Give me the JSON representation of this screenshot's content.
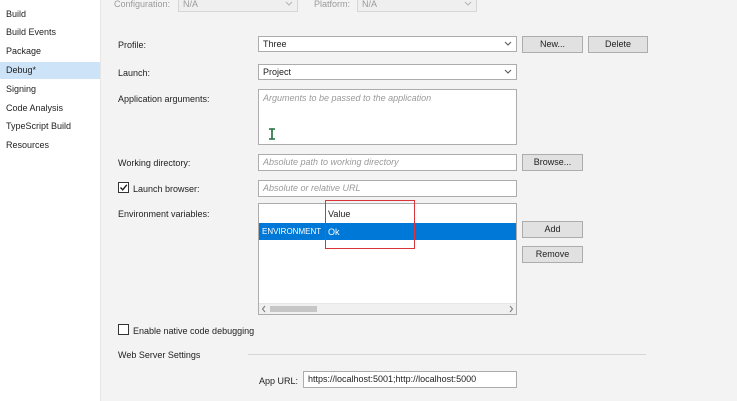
{
  "sidebar": {
    "items": [
      {
        "label": "Build"
      },
      {
        "label": "Build Events"
      },
      {
        "label": "Package"
      },
      {
        "label": "Debug*"
      },
      {
        "label": "Signing"
      },
      {
        "label": "Code Analysis"
      },
      {
        "label": "TypeScript Build"
      },
      {
        "label": "Resources"
      }
    ]
  },
  "top": {
    "configuration_label": "Configuration:",
    "configuration_value": "N/A",
    "platform_label": "Platform:",
    "platform_value": "N/A"
  },
  "profile": {
    "label": "Profile:",
    "value": "Three",
    "new_button": "New...",
    "delete_button": "Delete"
  },
  "launch": {
    "label": "Launch:",
    "value": "Project"
  },
  "app_args": {
    "label": "Application arguments:",
    "placeholder": "Arguments to be passed to the application"
  },
  "working_dir": {
    "label": "Working directory:",
    "placeholder": "Absolute path to working directory",
    "browse_button": "Browse..."
  },
  "launch_browser": {
    "label": "Launch browser:",
    "checked": true,
    "placeholder": "Absolute or relative URL"
  },
  "env_vars": {
    "label": "Environment variables:",
    "columns": [
      "",
      "Value"
    ],
    "rows": [
      {
        "name": "ENVIRONMENT",
        "value": "Ok"
      }
    ],
    "add_button": "Add",
    "remove_button": "Remove"
  },
  "native_debug": {
    "label": "Enable native code debugging",
    "checked": false
  },
  "web_server": {
    "section_label": "Web Server Settings",
    "app_url_label": "App URL:",
    "app_url_value": "https://localhost:5001;http://localhost:5000"
  },
  "colors": {
    "selection": "#0078d7",
    "sidebar_selected": "#cde3f7",
    "highlight_box": "#d9343a",
    "cursor": "#1f6e3a"
  }
}
